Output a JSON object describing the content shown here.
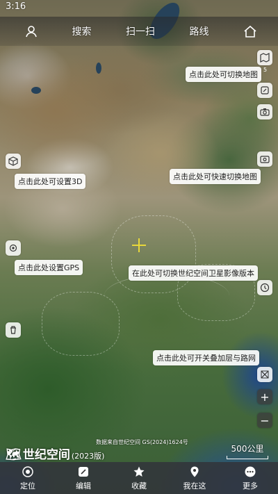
{
  "status_bar": {
    "time": "3:16"
  },
  "top_bar": {
    "search": "搜索",
    "scan": "扫一扫",
    "route": "路线"
  },
  "tips": {
    "switch_map": "点击此处可切换地图",
    "set_3d": "点击此处可设置3D",
    "quick_switch_map": "点击此处可快速切换地图",
    "set_gps": "点击此处设置GPS",
    "switch_version": "在此处可切换世纪空间卫星影像版本",
    "toggle_layers": "点击此处可开关叠加层与路网"
  },
  "badge_count": "5",
  "brand": {
    "name": "世纪空间",
    "version": "(2023版)"
  },
  "source_text": "数据来自世纪空间 GS(2024)1624号",
  "scale_text": "500公里",
  "zoom": {
    "in": "+",
    "out": "−"
  },
  "bottom_nav": [
    {
      "label": "定位",
      "icon": "locate-icon"
    },
    {
      "label": "编辑",
      "icon": "edit-icon"
    },
    {
      "label": "收藏",
      "icon": "star-icon"
    },
    {
      "label": "我在这",
      "icon": "pin-icon"
    },
    {
      "label": "更多",
      "icon": "more-icon"
    }
  ]
}
